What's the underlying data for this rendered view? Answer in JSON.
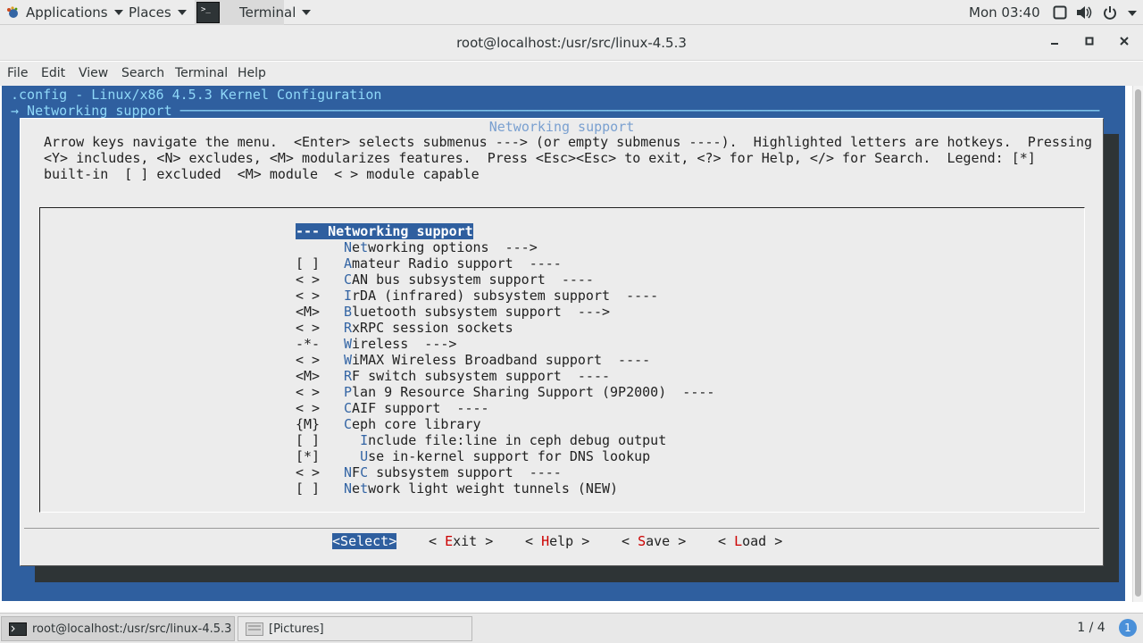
{
  "topbar": {
    "applications": "Applications",
    "places": "Places",
    "terminal_task": "Terminal",
    "clock": "Mon 03:40",
    "tray_icons": [
      "display-icon",
      "volume-icon",
      "power-icon"
    ]
  },
  "window": {
    "title": "root@localhost:/usr/src/linux-4.5.3",
    "controls": [
      "minimize",
      "maximize",
      "close"
    ]
  },
  "menubar": {
    "items": [
      "File",
      "Edit",
      "View",
      "Search",
      "Terminal",
      "Help"
    ]
  },
  "terminal": {
    "header_line": ".config - Linux/x86 4.5.3 Kernel Configuration",
    "breadcrumb_line": "→ Networking support ──────────────────────────────────────────────────────────────────────────────────────────────────────────────────",
    "dialog": {
      "title": "Networking support",
      "help_lines": [
        "Arrow keys navigate the menu.  <Enter> selects submenus ---> (or empty submenus ----).  Highlighted letters are hotkeys.  Pressing",
        "<Y> includes, <N> excludes, <M> modularizes features.  Press <Esc><Esc> to exit, <?> for Help, </> for Search.  Legend: [*]",
        "built-in  [ ] excluded  <M> module  < > module capable"
      ],
      "items": [
        {
          "state": "",
          "indent": "",
          "hotkey": "",
          "rest": "--- Networking support",
          "selected": true
        },
        {
          "state": "",
          "indent": "",
          "hotkey": "N",
          "rest": "e",
          "hotkey2": "t",
          "rest2": "working options  --->"
        },
        {
          "state": "[ ]",
          "indent": "",
          "hotkey": "A",
          "rest": "mateur Radio support  ----"
        },
        {
          "state": "< >",
          "indent": "",
          "hotkey": "C",
          "rest": "AN bus subsystem support  ----"
        },
        {
          "state": "< >",
          "indent": "",
          "hotkey": "I",
          "rest": "rDA (infrared) subsystem support  ----"
        },
        {
          "state": "<M>",
          "indent": "",
          "hotkey": "B",
          "rest": "luetooth subsystem support  --->"
        },
        {
          "state": "< >",
          "indent": "",
          "hotkey": "R",
          "rest": "xRPC session sockets"
        },
        {
          "state": "-*-",
          "indent": "",
          "hotkey": "W",
          "rest": "ireless  --->"
        },
        {
          "state": "< >",
          "indent": "",
          "hotkey": "W",
          "rest": "iMAX Wireless Broadband support  ----"
        },
        {
          "state": "<M>",
          "indent": "",
          "hotkey": "R",
          "rest": "F switch subsystem support  ----"
        },
        {
          "state": "< >",
          "indent": "",
          "hotkey": "P",
          "rest": "lan 9 Resource Sharing Support (9P2000)  ----"
        },
        {
          "state": "< >",
          "indent": "",
          "hotkey": "C",
          "rest": "AIF support  ----"
        },
        {
          "state": "{M}",
          "indent": "",
          "hotkey": "C",
          "rest": "eph core library"
        },
        {
          "state": "[ ]",
          "indent": "  ",
          "hotkey": "I",
          "rest": "nclude file:line in ceph debug output"
        },
        {
          "state": "[*]",
          "indent": "  ",
          "hotkey": "U",
          "rest": "se in-kernel support for DNS lookup"
        },
        {
          "state": "< >",
          "indent": "",
          "hotkey": "N",
          "rest": "F",
          "hotkey2": "C",
          "rest2": " subsystem support  ----"
        },
        {
          "state": "[ ]",
          "indent": "",
          "hotkey": "N",
          "rest": "e",
          "hotkey2": "t",
          "rest2": "work light weight tunnels (NEW)"
        }
      ],
      "buttons": [
        {
          "pre": "<",
          "hotkey": "S",
          "rest": "elect",
          "post": ">",
          "active": true
        },
        {
          "pre": "< ",
          "hotkey": "E",
          "rest": "xit",
          "post": " >",
          "active": false
        },
        {
          "pre": "< ",
          "hotkey": "H",
          "rest": "elp",
          "post": " >",
          "active": false
        },
        {
          "pre": "< ",
          "hotkey": "S",
          "rest": "ave",
          "post": " >",
          "active": false
        },
        {
          "pre": "< ",
          "hotkey": "L",
          "rest": "oad",
          "post": " >",
          "active": false
        }
      ]
    }
  },
  "taskbar": {
    "tasks": [
      {
        "label": "root@localhost:/usr/src/linux-4.5.3",
        "active": true
      },
      {
        "label": "[Pictures]",
        "active": false
      }
    ],
    "workspace": "1 / 4",
    "notification_count": "1"
  }
}
